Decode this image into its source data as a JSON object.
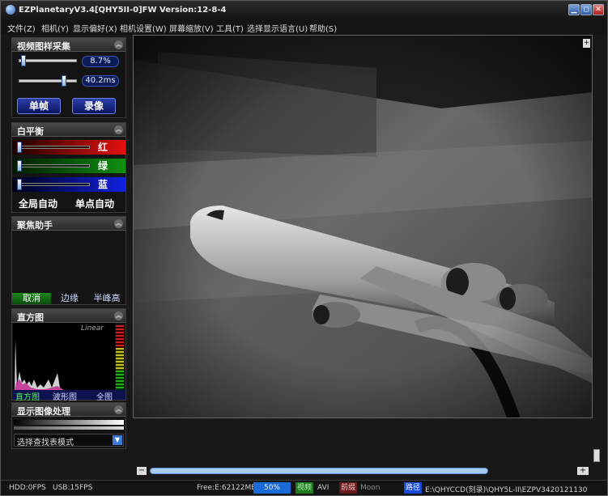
{
  "titlebar": {
    "title": "EZPlanetaryV3.4[QHY5II-0]FW Version:12-8-4",
    "min": "▁",
    "restore": "◻",
    "close": "✕"
  },
  "menu": [
    "文件(Z)",
    "相机(Y)",
    "显示偏好(X)",
    "相机设置(W)",
    "屏幕缩放(V)",
    "工具(T)",
    "选择显示语言(U)",
    "帮助(S)"
  ],
  "video_sampling": {
    "title": "视频图样采集",
    "gain_value": "8.7%",
    "exposure_value": "40.2ms",
    "gain_level": 0.05,
    "exposure_level": 0.8,
    "single_frame_btn": "单帧",
    "record_btn": "录像"
  },
  "white_balance": {
    "title": "白平衡",
    "red_label": "红",
    "green_label": "绿",
    "blue_label": "蓝",
    "auto_all_btn": "全局自动",
    "auto_point_btn": "单点自动",
    "colors": {
      "red": "#e61010",
      "green": "#109010",
      "blue": "#1020e0"
    }
  },
  "focus_assist": {
    "title": "聚焦助手",
    "cancel_tab": "取消",
    "edge_tab": "边缘",
    "fwhm_tab": "半峰高"
  },
  "histogram": {
    "title": "直方图",
    "scale_label": "Linear",
    "tab_histogram": "直方图",
    "tab_waveform": "波形图",
    "tab_full": "全图"
  },
  "display_processing": {
    "title": "显示图像处理",
    "lut_mode_placeholder": "选择查找表模式"
  },
  "statusbar": {
    "hdd_fps": "HDD:0FPS",
    "usb_fps": "USB:15FPS",
    "free_space": "Free:E:62122MB",
    "percent": "50%",
    "video_label": "视频",
    "video_format": "AVI",
    "front_label": "前缀",
    "front_value": "Moon",
    "path_label": "路径",
    "path_value": "E:\\QHYCCD(刻录)\\QHY5L-II\\EZPV3420121130"
  },
  "scroll": {
    "minus": "−",
    "plus": "+"
  }
}
